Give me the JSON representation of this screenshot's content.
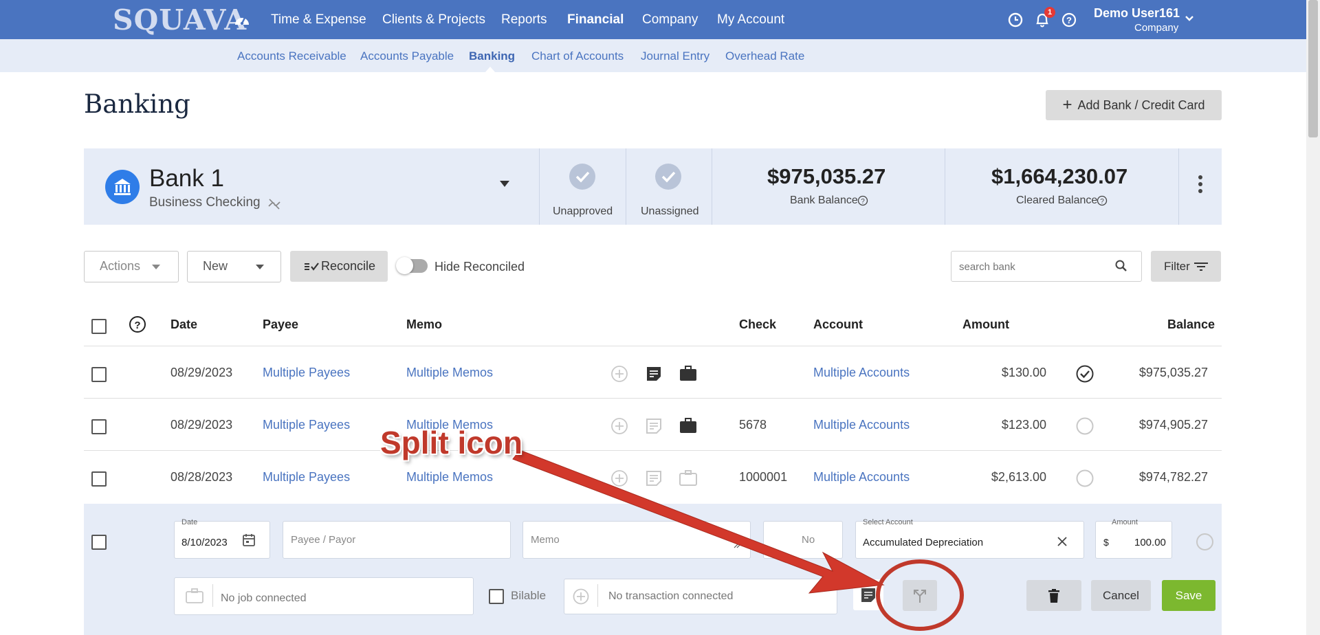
{
  "nav": {
    "logo": "SQUAVA",
    "items": [
      {
        "label": "Time & Expense"
      },
      {
        "label": "Clients & Projects"
      },
      {
        "label": "Reports"
      },
      {
        "label": "Financial"
      },
      {
        "label": "Company"
      },
      {
        "label": "My Account"
      }
    ],
    "notification_count": "1",
    "user_name": "Demo User161",
    "user_company": "Company"
  },
  "subnav": {
    "items": [
      {
        "label": "Accounts Receivable"
      },
      {
        "label": "Accounts Payable"
      },
      {
        "label": "Banking"
      },
      {
        "label": "Chart of Accounts"
      },
      {
        "label": "Journal Entry"
      },
      {
        "label": "Overhead Rate"
      }
    ]
  },
  "page": {
    "title": "Banking",
    "add_button": "Add Bank / Credit Card"
  },
  "bank": {
    "name": "Bank 1",
    "type": "Business Checking",
    "unapproved_label": "Unapproved",
    "unassigned_label": "Unassigned",
    "bank_balance": "$975,035.27",
    "bank_balance_label": "Bank Balance",
    "cleared_balance": "$1,664,230.07",
    "cleared_balance_label": "Cleared Balance"
  },
  "toolbar": {
    "actions_label": "Actions",
    "new_label": "New",
    "reconcile_label": "Reconcile",
    "hide_reconciled_label": "Hide Reconciled",
    "search_placeholder": "search bank",
    "filter_label": "Filter"
  },
  "table": {
    "headers": {
      "date": "Date",
      "payee": "Payee",
      "memo": "Memo",
      "check": "Check",
      "account": "Account",
      "amount": "Amount",
      "balance": "Balance"
    },
    "rows": [
      {
        "date": "08/29/2023",
        "payee": "Multiple Payees",
        "memo": "Multiple Memos",
        "check": "",
        "account": "Multiple Accounts",
        "amount": "$130.00",
        "balance": "$975,035.27"
      },
      {
        "date": "08/29/2023",
        "payee": "Multiple Payees",
        "memo": "Multiple Memos",
        "check": "5678",
        "account": "Multiple Accounts",
        "amount": "$123.00",
        "balance": "$974,905.27"
      },
      {
        "date": "08/28/2023",
        "payee": "Multiple Payees",
        "memo": "Multiple Memos",
        "check": "1000001",
        "account": "Multiple Accounts",
        "amount": "$2,613.00",
        "balance": "$974,782.27"
      }
    ]
  },
  "edit_row": {
    "date_label": "Date",
    "date_value": "8/10/2023",
    "payee_placeholder": "Payee / Payor",
    "memo_placeholder": "Memo",
    "check_placeholder": "No",
    "account_label": "Select Account",
    "account_value": "Accumulated Depreciation",
    "amount_label": "Amount",
    "amount_currency": "$",
    "amount_value": "100.00",
    "job_placeholder": "No job connected",
    "billable_label": "Bilable",
    "transaction_placeholder": "No transaction connected",
    "cancel_label": "Cancel",
    "save_label": "Save"
  },
  "annotation": {
    "text": "Split icon"
  },
  "colors": {
    "nav_bg": "#4a74c0",
    "subnav_bg": "#e6ecf7",
    "link": "#4a74c0",
    "save_green": "#7cb82f",
    "annotation_red": "#c0392b"
  }
}
